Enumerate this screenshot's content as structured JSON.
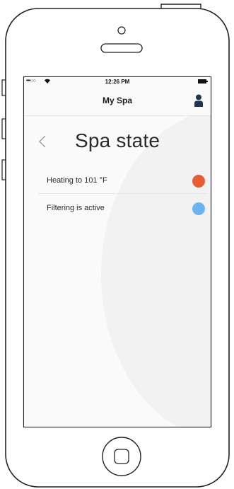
{
  "status_bar": {
    "signal": "•••○○",
    "time": "12:26 PM"
  },
  "nav": {
    "title": "My Spa",
    "user_icon": "user-icon"
  },
  "page": {
    "back_icon": "chevron-left-icon",
    "title": "Spa state"
  },
  "states": [
    {
      "label": "Heating to 101 °F",
      "color": "#e85c33"
    },
    {
      "label": "Filtering is active",
      "color": "#6ab4f0"
    }
  ],
  "colors": {
    "heating": "#e85c33",
    "filtering": "#6ab4f0",
    "user_icon": "#1f3550"
  }
}
